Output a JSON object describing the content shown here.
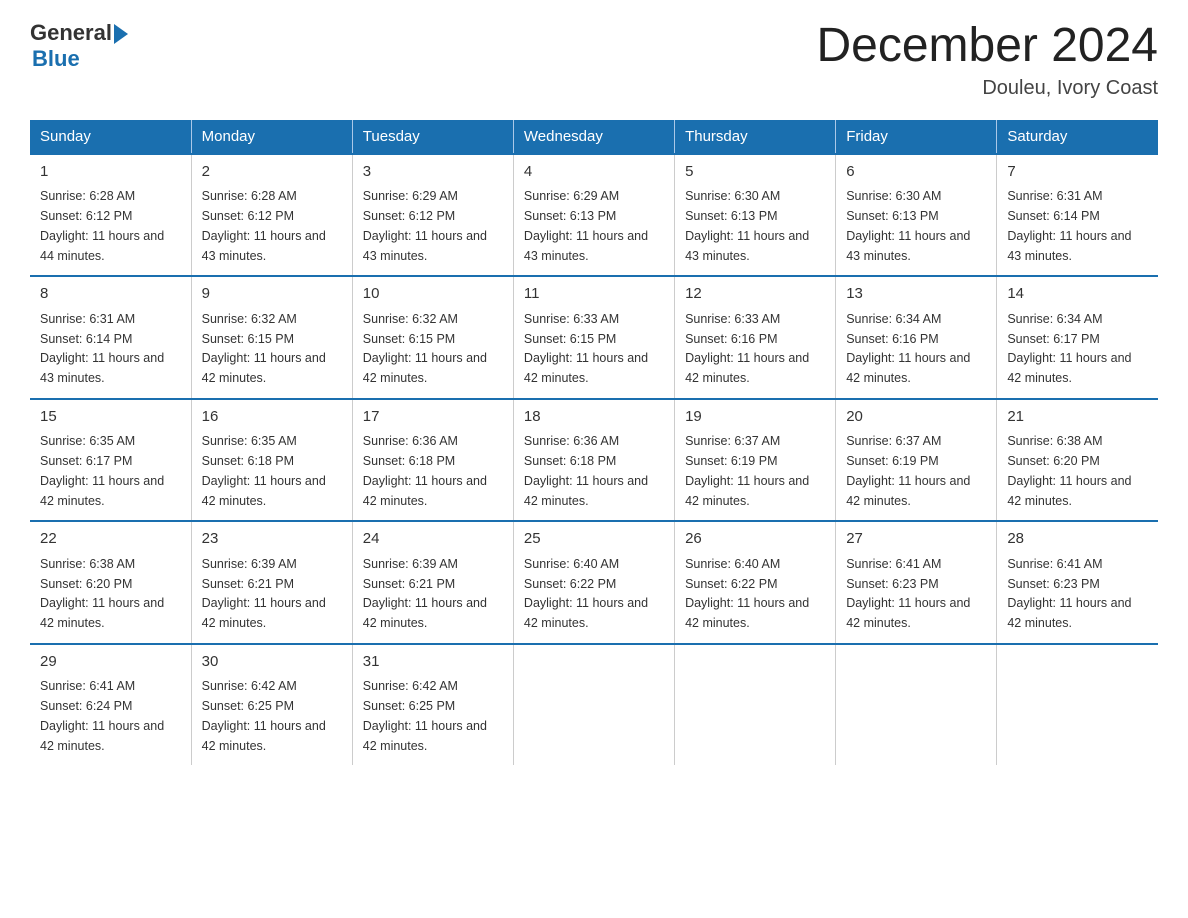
{
  "logo": {
    "general": "General",
    "blue": "Blue"
  },
  "header": {
    "month_year": "December 2024",
    "location": "Douleu, Ivory Coast"
  },
  "weekdays": [
    "Sunday",
    "Monday",
    "Tuesday",
    "Wednesday",
    "Thursday",
    "Friday",
    "Saturday"
  ],
  "weeks": [
    [
      {
        "day": "1",
        "sunrise": "6:28 AM",
        "sunset": "6:12 PM",
        "daylight": "11 hours and 44 minutes."
      },
      {
        "day": "2",
        "sunrise": "6:28 AM",
        "sunset": "6:12 PM",
        "daylight": "11 hours and 43 minutes."
      },
      {
        "day": "3",
        "sunrise": "6:29 AM",
        "sunset": "6:12 PM",
        "daylight": "11 hours and 43 minutes."
      },
      {
        "day": "4",
        "sunrise": "6:29 AM",
        "sunset": "6:13 PM",
        "daylight": "11 hours and 43 minutes."
      },
      {
        "day": "5",
        "sunrise": "6:30 AM",
        "sunset": "6:13 PM",
        "daylight": "11 hours and 43 minutes."
      },
      {
        "day": "6",
        "sunrise": "6:30 AM",
        "sunset": "6:13 PM",
        "daylight": "11 hours and 43 minutes."
      },
      {
        "day": "7",
        "sunrise": "6:31 AM",
        "sunset": "6:14 PM",
        "daylight": "11 hours and 43 minutes."
      }
    ],
    [
      {
        "day": "8",
        "sunrise": "6:31 AM",
        "sunset": "6:14 PM",
        "daylight": "11 hours and 43 minutes."
      },
      {
        "day": "9",
        "sunrise": "6:32 AM",
        "sunset": "6:15 PM",
        "daylight": "11 hours and 42 minutes."
      },
      {
        "day": "10",
        "sunrise": "6:32 AM",
        "sunset": "6:15 PM",
        "daylight": "11 hours and 42 minutes."
      },
      {
        "day": "11",
        "sunrise": "6:33 AM",
        "sunset": "6:15 PM",
        "daylight": "11 hours and 42 minutes."
      },
      {
        "day": "12",
        "sunrise": "6:33 AM",
        "sunset": "6:16 PM",
        "daylight": "11 hours and 42 minutes."
      },
      {
        "day": "13",
        "sunrise": "6:34 AM",
        "sunset": "6:16 PM",
        "daylight": "11 hours and 42 minutes."
      },
      {
        "day": "14",
        "sunrise": "6:34 AM",
        "sunset": "6:17 PM",
        "daylight": "11 hours and 42 minutes."
      }
    ],
    [
      {
        "day": "15",
        "sunrise": "6:35 AM",
        "sunset": "6:17 PM",
        "daylight": "11 hours and 42 minutes."
      },
      {
        "day": "16",
        "sunrise": "6:35 AM",
        "sunset": "6:18 PM",
        "daylight": "11 hours and 42 minutes."
      },
      {
        "day": "17",
        "sunrise": "6:36 AM",
        "sunset": "6:18 PM",
        "daylight": "11 hours and 42 minutes."
      },
      {
        "day": "18",
        "sunrise": "6:36 AM",
        "sunset": "6:18 PM",
        "daylight": "11 hours and 42 minutes."
      },
      {
        "day": "19",
        "sunrise": "6:37 AM",
        "sunset": "6:19 PM",
        "daylight": "11 hours and 42 minutes."
      },
      {
        "day": "20",
        "sunrise": "6:37 AM",
        "sunset": "6:19 PM",
        "daylight": "11 hours and 42 minutes."
      },
      {
        "day": "21",
        "sunrise": "6:38 AM",
        "sunset": "6:20 PM",
        "daylight": "11 hours and 42 minutes."
      }
    ],
    [
      {
        "day": "22",
        "sunrise": "6:38 AM",
        "sunset": "6:20 PM",
        "daylight": "11 hours and 42 minutes."
      },
      {
        "day": "23",
        "sunrise": "6:39 AM",
        "sunset": "6:21 PM",
        "daylight": "11 hours and 42 minutes."
      },
      {
        "day": "24",
        "sunrise": "6:39 AM",
        "sunset": "6:21 PM",
        "daylight": "11 hours and 42 minutes."
      },
      {
        "day": "25",
        "sunrise": "6:40 AM",
        "sunset": "6:22 PM",
        "daylight": "11 hours and 42 minutes."
      },
      {
        "day": "26",
        "sunrise": "6:40 AM",
        "sunset": "6:22 PM",
        "daylight": "11 hours and 42 minutes."
      },
      {
        "day": "27",
        "sunrise": "6:41 AM",
        "sunset": "6:23 PM",
        "daylight": "11 hours and 42 minutes."
      },
      {
        "day": "28",
        "sunrise": "6:41 AM",
        "sunset": "6:23 PM",
        "daylight": "11 hours and 42 minutes."
      }
    ],
    [
      {
        "day": "29",
        "sunrise": "6:41 AM",
        "sunset": "6:24 PM",
        "daylight": "11 hours and 42 minutes."
      },
      {
        "day": "30",
        "sunrise": "6:42 AM",
        "sunset": "6:25 PM",
        "daylight": "11 hours and 42 minutes."
      },
      {
        "day": "31",
        "sunrise": "6:42 AM",
        "sunset": "6:25 PM",
        "daylight": "11 hours and 42 minutes."
      },
      null,
      null,
      null,
      null
    ]
  ]
}
